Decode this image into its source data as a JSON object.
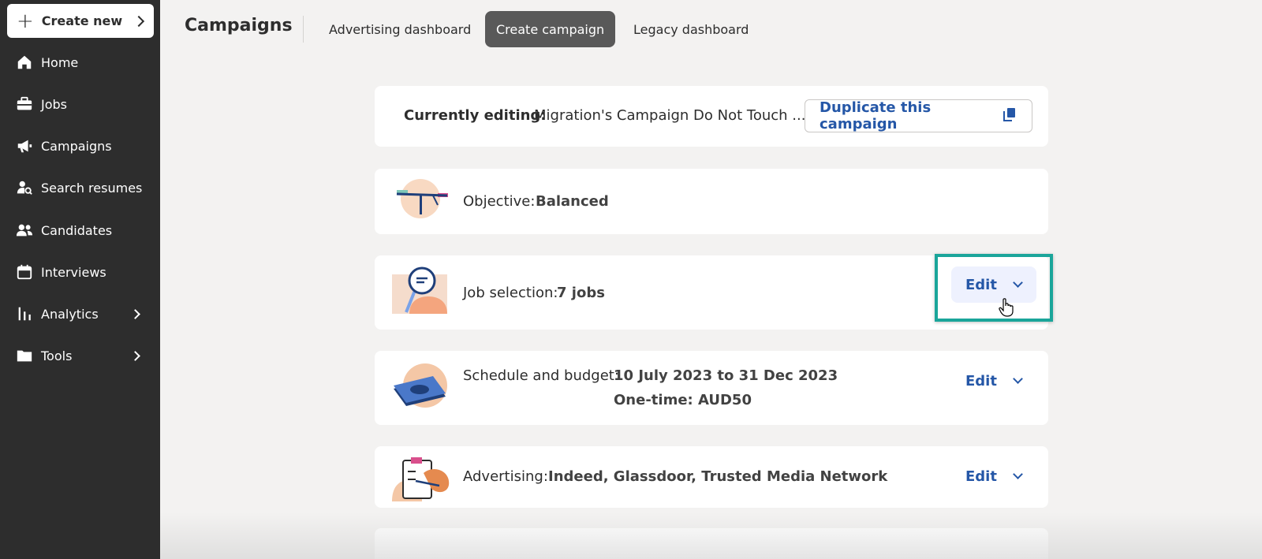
{
  "sidebar": {
    "create_new": "Create new",
    "items": [
      {
        "label": "Home",
        "icon": "home-icon"
      },
      {
        "label": "Jobs",
        "icon": "briefcase-icon"
      },
      {
        "label": "Campaigns",
        "icon": "megaphone-icon"
      },
      {
        "label": "Search resumes",
        "icon": "search-person-icon"
      },
      {
        "label": "Candidates",
        "icon": "people-icon"
      },
      {
        "label": "Interviews",
        "icon": "calendar-icon"
      },
      {
        "label": "Analytics",
        "icon": "bar-chart-icon",
        "has_submenu": true
      },
      {
        "label": "Tools",
        "icon": "folder-icon",
        "has_submenu": true
      }
    ]
  },
  "header": {
    "title": "Campaigns",
    "tabs": [
      {
        "label": "Advertising dashboard",
        "active": false
      },
      {
        "label": "Create campaign",
        "active": true
      },
      {
        "label": "Legacy dashboard",
        "active": false
      }
    ]
  },
  "editing": {
    "label": "Currently editing:",
    "value": "Migration's Campaign Do Not Touch ...",
    "duplicate_label": "Duplicate this campaign"
  },
  "rows": {
    "objective": {
      "label": "Objective:",
      "value": "Balanced"
    },
    "job_selection": {
      "label": "Job selection:",
      "value": "7 jobs",
      "edit": "Edit"
    },
    "schedule": {
      "label": "Schedule and budget:",
      "value_line1": "10 July 2023 to 31 Dec 2023",
      "value_line2": "One-time: AUD50",
      "edit": "Edit"
    },
    "advertising": {
      "label": "Advertising:",
      "value": "Indeed, Glassdoor, Trusted Media Network",
      "edit": "Edit"
    }
  },
  "colors": {
    "sidebar_bg": "#2d2d2d",
    "link_blue": "#2557a7",
    "highlight": "#1aa59a",
    "active_tab": "#595959"
  }
}
